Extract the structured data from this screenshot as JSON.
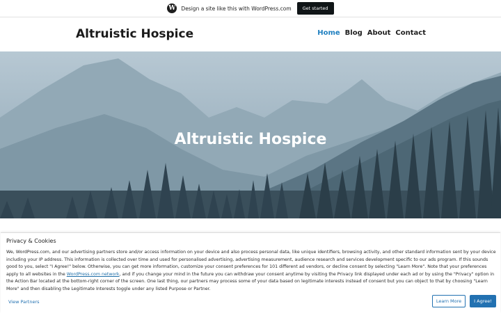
{
  "promo_bar": {
    "logo_icon": "wordpress-logo-icon",
    "logo_glyph": "W",
    "text": "Design a site like this with WordPress.com",
    "cta_label": "Get started"
  },
  "header": {
    "site_title": "Altruistic Hospice",
    "nav": [
      {
        "label": "Home",
        "active": true
      },
      {
        "label": "Blog",
        "active": false
      },
      {
        "label": "About",
        "active": false
      },
      {
        "label": "Contact",
        "active": false
      }
    ],
    "active_color": "#1e7fc0"
  },
  "hero": {
    "title": "Altruistic Hospice"
  },
  "consent": {
    "title": "Privacy & Cookies",
    "text_before_link": "We, WordPress.com, and our advertising partners store and/or access information on your device and also process personal data, like unique identifiers, browsing activity, and other standard information sent by your device including your IP address. This information is collected over time and used for personalised advertising, advertising measurement, audience research and services development specific to our ads program. If this sounds good to you, select \"I Agree!\" below. Otherwise, you can get more information, customize your consent preferences for 101 different ad vendors, or decline consent by selecting \"Learn More\". Note that your preferences apply to all websites in the ",
    "link_text": "WordPress.com network",
    "text_after_link": ", and if you change your mind in the future you can withdraw your consent anytime by visiting the Privacy link displayed under each ad or by using the \"Privacy\" option in the Action Bar located at the bottom-right corner of the screen. One last thing, our partners may process some of your data based on legitimate interests instead of consent but you can object to that by choosing \"Learn More\" and then disabling the Legitimate Interests toggle under any listed Purpose or Partner.",
    "view_partners_label": "View Partners",
    "learn_more_label": "Learn More",
    "agree_label": "I Agree!",
    "accent_color": "#2271b1"
  }
}
